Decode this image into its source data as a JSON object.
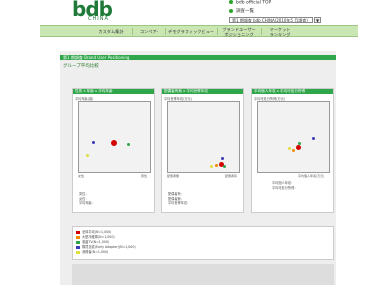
{
  "header": {
    "logo_main": "bdb",
    "logo_sub": "CHINA",
    "link_official": "bdb official TOP",
    "link_list": "調査一覧",
    "period_select": "第1 期調査 bdb CHINA(2010年5 月調査)",
    "period_arrow": "▼"
  },
  "nav": {
    "items": [
      {
        "label": "カスタム集計"
      },
      {
        "label": "コンペア-"
      },
      {
        "label": "デモグラフィックビュー"
      },
      {
        "label": "ブランドユーザー",
        "label2": "ポジショニング"
      },
      {
        "label": "マーケット",
        "label2": "ランキング"
      }
    ]
  },
  "section": {
    "title": "第1 期調査 Brand User Positioning",
    "subtitle": "グループ平均比較"
  },
  "panels": [
    {
      "title": "性別 x 年齢 x 平均年齢",
      "ytitle": "平均年齢(歳)",
      "xlabel_left": "女性",
      "xlabel_right": "男性",
      "notes": [
        "男性：",
        "女性：",
        "平均年齢："
      ]
    },
    {
      "title": "配偶者有無 x 平均世帯年収",
      "ytitle": "平均世帯年収(万元)",
      "xlabel_left": "配偶者無",
      "xlabel_right": "配偶者有",
      "notes": [
        "配偶者有：",
        "配偶者無：",
        "平均世帯年収："
      ]
    },
    {
      "title": "平均個人年収 x 平均可処分所得",
      "ytitle": "平均可処分所得(万元)",
      "xlabel_right": "平均個人年収(万元)",
      "notes": [
        "平均個人年収：",
        "平均可処分所得："
      ]
    }
  ],
  "legend": {
    "items": [
      {
        "label": "全体平均(N=1,000)",
        "color": "#d40000"
      },
      {
        "label": "大型冷蔵庫(N=1,000)",
        "color": "#f28c00"
      },
      {
        "label": "液晶TV(N=1,000)",
        "color": "#2fa64a"
      },
      {
        "label": "購買意欲(Early Adopter)(N=1,000)",
        "color": "#3b3bb5"
      },
      {
        "label": "消費者(N=1,000)",
        "color": "#e0e040"
      }
    ]
  }
}
